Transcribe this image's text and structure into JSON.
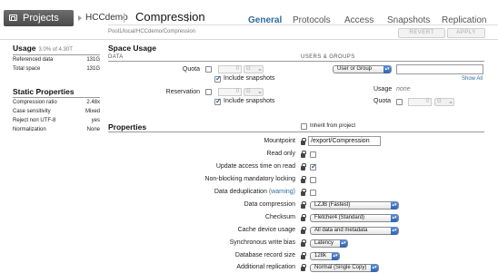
{
  "header": {
    "projects_label": "Projects",
    "pool_name": "HCCdemo",
    "share_name": "Compression",
    "path": "Pool1/local/HCCdemo/Compression",
    "tabs": [
      "General",
      "Protocols",
      "Access",
      "Snapshots",
      "Replication"
    ],
    "active_tab": "General",
    "revert_label": "REVERT",
    "apply_label": "APPLY"
  },
  "usage": {
    "title": "Usage",
    "summary": "3.0% of 4.30T",
    "rows": [
      {
        "label": "Referenced data",
        "value": "131G"
      },
      {
        "label": "Total space",
        "value": "131G"
      }
    ]
  },
  "static_properties": {
    "title": "Static Properties",
    "rows": [
      {
        "label": "Compression ratio",
        "value": "2.48x"
      },
      {
        "label": "Case sensitivity",
        "value": "Mixed"
      },
      {
        "label": "Reject non UTF-8",
        "value": "yes"
      },
      {
        "label": "Normalization",
        "value": "None"
      }
    ]
  },
  "space_usage": {
    "title": "Space Usage",
    "data_caption": "DATA",
    "users_caption": "USERS & GROUPS",
    "quota_label": "Quota",
    "quota_value": "0",
    "quota_unit": "G",
    "include_snapshots_label": "Include snapshots",
    "reservation_label": "Reservation",
    "reservation_value": "0",
    "reservation_unit": "G",
    "user_or_group": "User or Group",
    "user_input": "",
    "show_all": "Show All",
    "usage_label": "Usage",
    "usage_value": "none",
    "ug_quota_label": "Quota",
    "ug_quota_value": "0",
    "ug_quota_unit": "G"
  },
  "properties": {
    "title": "Properties",
    "inherit_label": "Inherit from project",
    "mountpoint_label": "Mountpoint",
    "mountpoint_value": "/export/Compression",
    "read_only_label": "Read only",
    "update_atime_label": "Update access time on read",
    "nbmand_label": "Non-blocking mandatory locking",
    "dedup_label": "Data deduplication",
    "dedup_warning": "(warning)",
    "compression_label": "Data compression",
    "compression_value": "LZJB (Fastest)",
    "checksum_label": "Checksum",
    "checksum_value": "Fletcher4 (Standard)",
    "cache_label": "Cache device usage",
    "cache_value": "All data and metadata",
    "sync_label": "Synchronous write bias",
    "sync_value": "Latency",
    "recordsize_label": "Database record size",
    "recordsize_value": "128k",
    "replication_label": "Additional replication",
    "replication_value": "Normal (Single Copy)"
  }
}
